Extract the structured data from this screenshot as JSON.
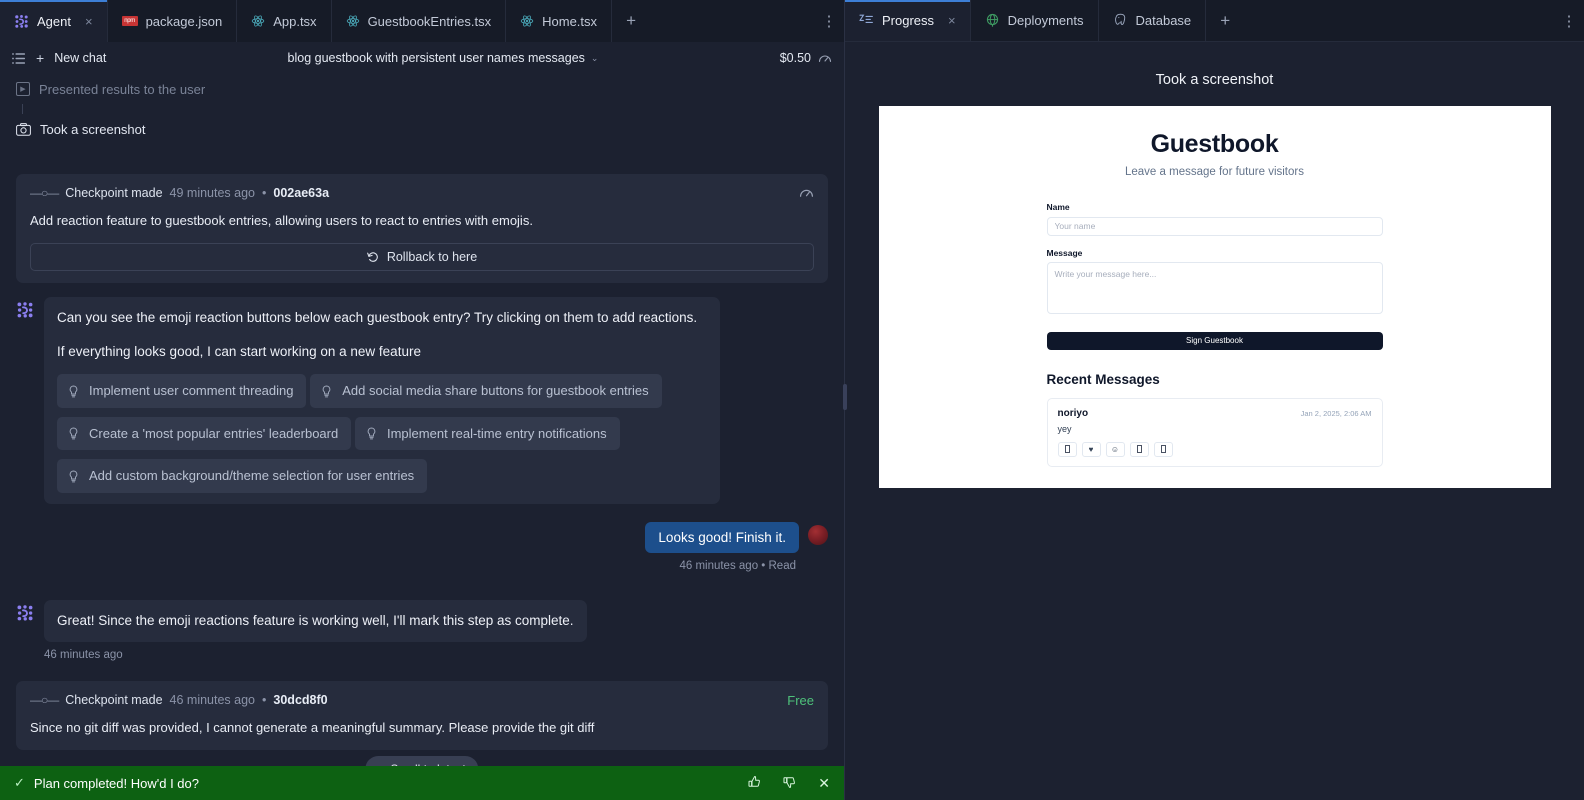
{
  "editor": {
    "tabs": [
      {
        "label": "Agent",
        "icon": "agent-logo-icon",
        "active": true,
        "closable": true
      },
      {
        "label": "package.json",
        "icon": "npm-icon",
        "active": false,
        "closable": false
      },
      {
        "label": "App.tsx",
        "icon": "react-icon",
        "active": false,
        "closable": false
      },
      {
        "label": "GuestbookEntries.tsx",
        "icon": "react-icon",
        "active": false,
        "closable": false
      },
      {
        "label": "Home.tsx",
        "icon": "react-icon",
        "active": false,
        "closable": false
      }
    ],
    "new_tab_label": "+",
    "kebab_label": "⋮",
    "close_label": "×"
  },
  "chat_header": {
    "hamburger_icon": "list-icon",
    "plus_label": "+",
    "new_chat_label": "New chat",
    "title": "blog guestbook with persistent user names messages",
    "caret": "∨",
    "cost": "$0.50",
    "gauge_icon": "gauge-icon"
  },
  "timeline": {
    "step_presented": "Presented results to the user",
    "step_screenshot": "Took a screenshot"
  },
  "checkpoint1": {
    "label": "Checkpoint made",
    "time": "49 minutes ago",
    "separator": "•",
    "hash": "002ae63a",
    "body": "Add reaction feature to guestbook entries, allowing users to react to entries with emojis.",
    "rollback_label": "Rollback to here",
    "rollback_icon": "undo-icon",
    "gauge_icon": "gauge-icon"
  },
  "assistant_message": {
    "paragraph1": "Can you see the emoji reaction buttons below each guestbook entry? Try clicking on them to add reactions.",
    "paragraph2": "If everything looks good, I can start working on a new feature",
    "suggestions": [
      "Implement user comment threading",
      "Add social media share buttons for guestbook entries",
      "Create a 'most popular entries' leaderboard",
      "Implement real-time entry notifications",
      "Add custom background/theme selection for user entries"
    ],
    "bulb_icon": "lightbulb-icon"
  },
  "user_message": {
    "text": "Looks good! Finish it.",
    "meta": "46 minutes ago • Read"
  },
  "assistant_message2": {
    "text": "Great! Since the emoji reactions feature is working well, I'll mark this step as complete.",
    "meta": "46 minutes ago"
  },
  "checkpoint2": {
    "label": "Checkpoint made",
    "time": "46 minutes ago",
    "separator": "•",
    "hash": "30dcd8f0",
    "badge": "Free",
    "body": "Since no git diff was provided, I cannot generate a meaningful summary. Please provide the git diff"
  },
  "scroll_button": {
    "arrow": "↓",
    "label": "Scroll to latest"
  },
  "toast": {
    "check": "✓",
    "text": "Plan completed! How'd I do?",
    "thumbs_up": "👍",
    "thumbs_down": "👎",
    "close": "✕"
  },
  "right_panel": {
    "tabs": [
      {
        "label": "Progress",
        "icon": "terminal-icon",
        "active": true,
        "closable": true
      },
      {
        "label": "Deployments",
        "icon": "globe-icon",
        "active": false,
        "closable": false
      },
      {
        "label": "Database",
        "icon": "postgres-elephant-icon",
        "active": false,
        "closable": false
      }
    ],
    "new_tab_label": "+",
    "kebab_label": "⋮",
    "close_label": "×",
    "preview_caption": "Took a screenshot"
  },
  "guestbook": {
    "title": "Guestbook",
    "subtitle": "Leave a message for future visitors",
    "name_label": "Name",
    "name_placeholder": "Your name",
    "name_value": "",
    "message_label": "Message",
    "message_placeholder": "Write your message here...",
    "message_value": "",
    "submit_label": "Sign Guestbook",
    "recent_heading": "Recent Messages",
    "entries": [
      {
        "name": "noriyo",
        "date": "Jan 2, 2025, 2:06 AM",
        "body": "yey",
        "reactions": [
          "▢",
          "♥",
          "☺",
          "▢",
          "▢"
        ]
      }
    ]
  },
  "colors": {
    "app_bg": "#1c2130",
    "tabbar_bg": "#161b27",
    "card_bg": "#262c3d",
    "chip_bg": "#333a4d",
    "accent_blue": "#3d7fd6",
    "user_bubble": "#1d4f8c",
    "toast_green": "#0d6112",
    "free_green": "#4ec27b",
    "agent_purple": "#8b7ff0",
    "npm_red": "#c73434",
    "react_cyan": "#4aa8b8"
  }
}
